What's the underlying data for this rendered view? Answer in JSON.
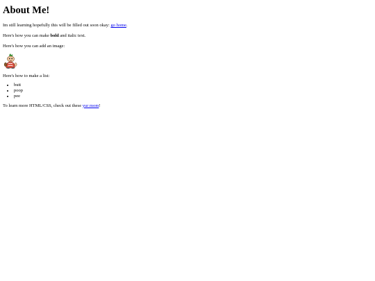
{
  "heading": "About Me!",
  "intro": {
    "text": "Im still learning hopefully this will be filled out soon okay: ",
    "link": "go home",
    "after": "."
  },
  "format": {
    "before": "Here's how you can make ",
    "bold": "bold",
    "after": " and italic text."
  },
  "image_intro": "Here's how you can add an image:",
  "image_icon": "cartoon-character-icon",
  "list_intro": "Here's how to make a list:",
  "list_items": [
    "butt",
    "poop",
    "pee"
  ],
  "outro": {
    "before": "To learn more HTML/CSS, check out these ",
    "link": "yur mom",
    "after": "!"
  }
}
